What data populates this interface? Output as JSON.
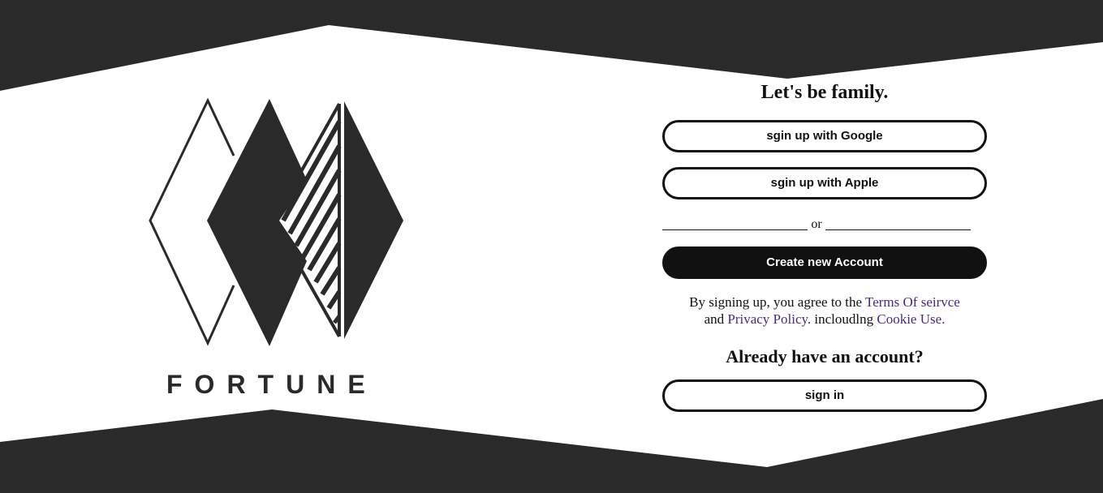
{
  "brand": {
    "name": "FORTUNE"
  },
  "signup": {
    "headline": "Let's be family.",
    "google_label": "sgin up with Google",
    "apple_label": "sgin up with Apple",
    "divider_text": "or",
    "create_label": "Create new Account"
  },
  "terms": {
    "prefix": "By signing up, you agree to the ",
    "terms_link": "Terms Of seirvce",
    "middle": " and ",
    "privacy_link": "Privacy Policy.",
    "middle2": " incloudlng ",
    "cookie_link": "Cookie Use."
  },
  "signin": {
    "headline": "Already have an account?",
    "button_label": "sign in"
  },
  "colors": {
    "background_dark": "#2a2a2a",
    "background_light": "#ffffff",
    "link": "#4a2a7a",
    "primary_button": "#111111"
  }
}
